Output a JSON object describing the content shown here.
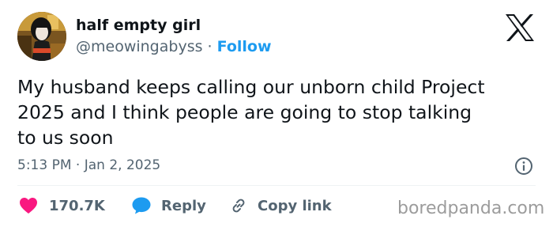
{
  "author": {
    "display_name": "half empty girl",
    "handle": "@meowingabyss",
    "separator": "·",
    "follow_label": "Follow"
  },
  "tweet": {
    "text": "My husband keeps calling our unborn child Project\n2025 and I think people are going to stop talking\nto us soon",
    "timestamp": "5:13 PM · Jan 2, 2025"
  },
  "actions": {
    "like_count": "170.7K",
    "reply_label": "Reply",
    "copy_link_label": "Copy link"
  },
  "icons": {
    "platform": "x-logo-icon",
    "info": "info-icon",
    "like": "heart-icon",
    "reply": "speech-bubble-icon",
    "copy": "link-icon"
  },
  "colors": {
    "text": "#0f1419",
    "secondary": "#536471",
    "accent": "#1d9bf0",
    "like": "#f91880"
  },
  "watermark": "boredpanda.com"
}
